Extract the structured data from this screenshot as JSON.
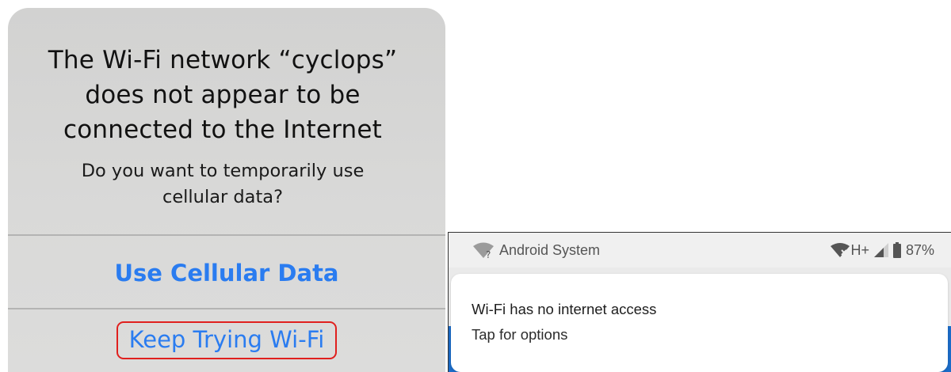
{
  "ios_alert": {
    "title_lines": [
      "The Wi-Fi network “cyclops”",
      "does not appear to be",
      "connected to the Internet"
    ],
    "message_lines": [
      "Do you want to temporarily use",
      "cellular data?"
    ],
    "buttons": {
      "use_cellular": "Use Cellular Data",
      "keep_trying": "Keep Trying Wi-Fi"
    },
    "colors": {
      "button_text": "#2a7cf0",
      "highlight_border": "#e0201e"
    }
  },
  "android": {
    "status_bar": {
      "app_name": "Android System",
      "app_icon": "wifi-question-icon",
      "network_label": "H+",
      "icons": [
        "wifi-no-internet-icon",
        "cell-signal-icon",
        "battery-icon"
      ],
      "battery_percent": "87%"
    },
    "notification": {
      "title": "Wi-Fi has no internet access",
      "text": "Tap for options"
    }
  }
}
